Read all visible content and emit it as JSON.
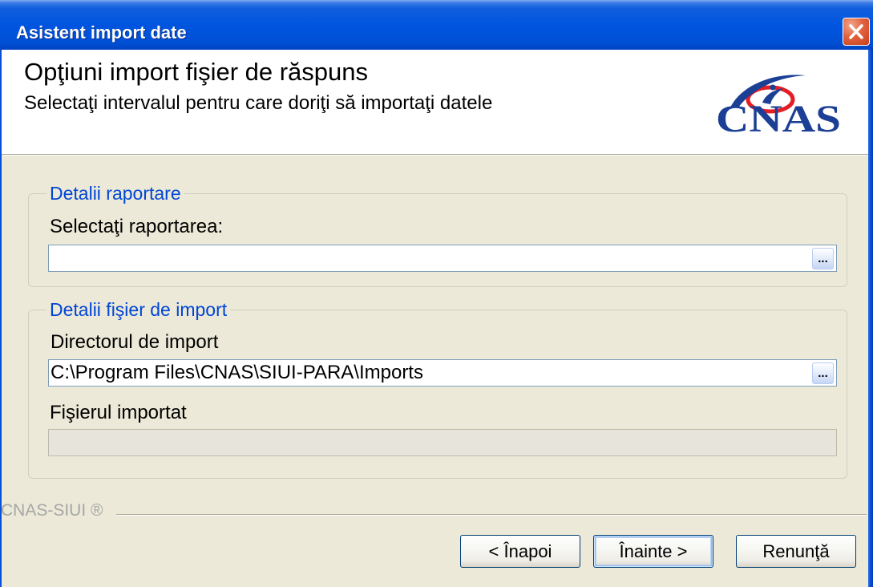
{
  "window": {
    "title": "Asistent import date",
    "close_icon": "close-icon"
  },
  "header": {
    "title": "Opţiuni import fişier de răspuns",
    "subtitle": "Selectaţi intervalul pentru care doriţi să importaţi datele",
    "logo": {
      "icon": "cnas-logo",
      "text": "CNAS"
    }
  },
  "report_details": {
    "legend": "Detalii raportare",
    "select_label": "Selectaţi raportarea:",
    "select_value": "",
    "browse_label": "..."
  },
  "import_file_details": {
    "legend": "Detalii fişier de import",
    "directory_label": "Directorul de import",
    "directory_value": "C:\\Program Files\\CNAS\\SIUI-PARA\\Imports",
    "directory_browse_label": "...",
    "file_label": "Fişierul importat",
    "file_value": ""
  },
  "footer": {
    "brand": "CNAS-SIUI ®"
  },
  "buttons": {
    "back": "< Înapoi",
    "next": "Înainte >",
    "cancel": "Renunţă"
  },
  "colors": {
    "titlebar": "#0055DF",
    "window_background": "#ECE9D8",
    "group_legend": "#0046D5",
    "close_button": "#E2623E",
    "logo_blue": "#1B3F94",
    "logo_red": "#E31E24"
  }
}
